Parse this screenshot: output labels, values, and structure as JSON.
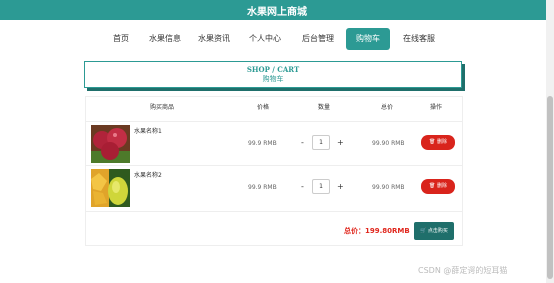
{
  "header": {
    "title": "水果网上商城",
    "bg": "#2c9a94"
  },
  "nav": {
    "items": [
      {
        "label": "首页",
        "active": false
      },
      {
        "label": "水果信息",
        "active": false
      },
      {
        "label": "水果资讯",
        "active": false
      },
      {
        "label": "个人中心",
        "active": false
      },
      {
        "label": "后台管理",
        "active": false
      },
      {
        "label": "购物车",
        "active": true
      },
      {
        "label": "在线客服",
        "active": false
      }
    ]
  },
  "cart_title": {
    "en": "SHOP / CART",
    "cn": "购物车"
  },
  "table": {
    "headers": [
      "购买商品",
      "价格",
      "数量",
      "总价",
      "操作"
    ],
    "rows": [
      {
        "name": "水果名称1",
        "price": "99.9 RMB",
        "qty": "1",
        "minus": "-",
        "plus": "+",
        "total": "99.90 RMB",
        "delete": "删除",
        "image": "red-fruit"
      },
      {
        "name": "水果名称2",
        "price": "99.9 RMB",
        "qty": "1",
        "minus": "-",
        "plus": "+",
        "total": "99.90 RMB",
        "delete": "删除",
        "image": "mango"
      }
    ]
  },
  "summary": {
    "total_label": "总价：199.80RMB",
    "checkout_label": "点击购买"
  },
  "watermark": "CSDN @薛定谔的短耳猫",
  "colors": {
    "accent": "#2c9a94",
    "danger": "#d9241c",
    "price_red": "#e0261c"
  }
}
